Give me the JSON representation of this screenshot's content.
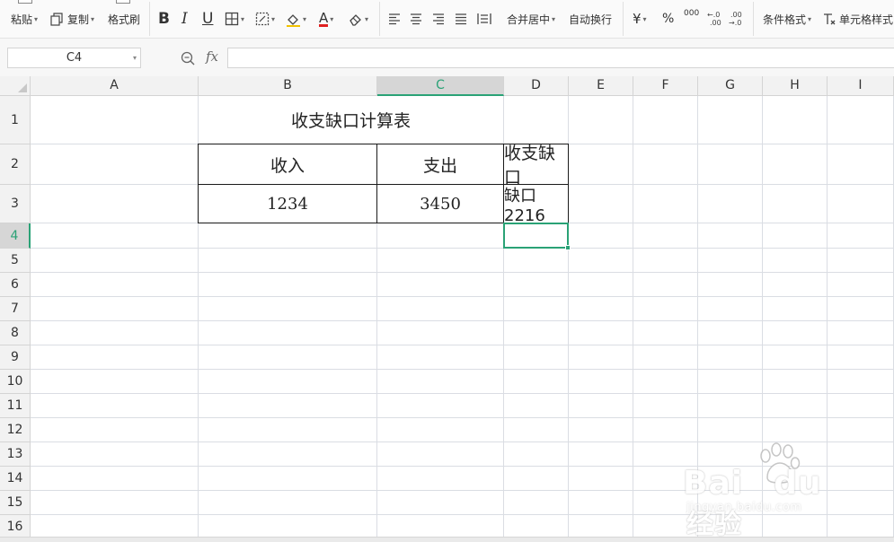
{
  "toolbar": {
    "paste_label": "粘贴",
    "copy_label": "复制",
    "format_painter_label": "格式刷",
    "bold_label": "B",
    "italic_label": "I",
    "underline_label": "U",
    "font_color_label": "A",
    "merge_center_label": "合并居中",
    "wrap_text_label": "自动换行",
    "currency_label": "¥",
    "percent_label": "%",
    "thousands_label": "000",
    "inc_decimal_label": "+.0\n.00",
    "dec_decimal_label": ".00\n→.0",
    "conditional_format_label": "条件格式",
    "cell_style_label": "单元格样式"
  },
  "formula_bar": {
    "name_box": "C4",
    "fx_label": "fx",
    "formula_value": ""
  },
  "grid": {
    "columns": [
      "A",
      "B",
      "C",
      "D",
      "E",
      "F",
      "G",
      "H",
      "I"
    ],
    "rows": [
      "1",
      "2",
      "3",
      "4",
      "5",
      "6",
      "7",
      "8",
      "9",
      "10",
      "11",
      "12",
      "13",
      "14",
      "15",
      "16"
    ],
    "active_column": "C",
    "active_row": "4",
    "selected_cell": "C4",
    "cells": {
      "title": "收支缺口计算表",
      "a2": "收入",
      "b2": "支出",
      "c2": "收支缺口",
      "a3": "1234",
      "b3": "3450",
      "c3": "缺口2216"
    }
  },
  "watermark": {
    "brand": "Bai",
    "brand_tail": "du",
    "brand_cn": "经验",
    "url": "jingyan.baidu.com"
  },
  "colors": {
    "accent": "#2aa276",
    "grid_line": "#dadde3",
    "header_bg": "#f2f2f2"
  }
}
